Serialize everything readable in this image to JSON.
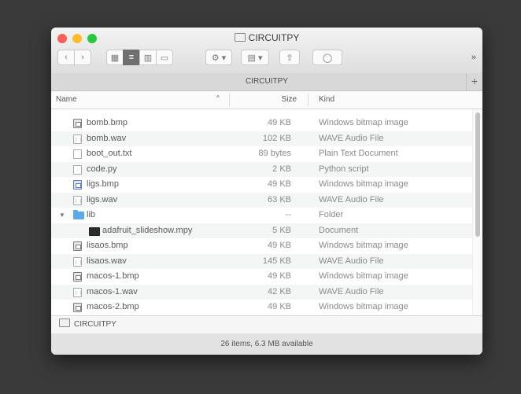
{
  "window": {
    "title": "CIRCUITPY",
    "path_title": "CIRCUITPY",
    "add_tab": "+",
    "more": "»"
  },
  "toolbar": {
    "back": "‹",
    "forward": "›",
    "view_icons": "▦",
    "view_list": "≡",
    "view_columns": "▥",
    "view_gallery": "▭",
    "action": "⚙ ▾",
    "group": "▤ ▾",
    "share": "⇧",
    "tags": "◯"
  },
  "columns": {
    "name": "Name",
    "sort": "^",
    "size": "Size",
    "kind": "Kind"
  },
  "files": [
    {
      "name": "bomb.bmp",
      "size": "49 KB",
      "kind": "Windows bitmap image",
      "icon": "image-icon",
      "indent": 0
    },
    {
      "name": "bomb.wav",
      "size": "102 KB",
      "kind": "WAVE Audio File",
      "icon": "audio-icon",
      "indent": 0
    },
    {
      "name": "boot_out.txt",
      "size": "89 bytes",
      "kind": "Plain Text Document",
      "icon": "text-file-icon",
      "indent": 0
    },
    {
      "name": "code.py",
      "size": "2 KB",
      "kind": "Python script",
      "icon": "document-icon",
      "indent": 0
    },
    {
      "name": "ligs.bmp",
      "size": "49 KB",
      "kind": "Windows bitmap image",
      "icon": "image-icon-blue",
      "indent": 0
    },
    {
      "name": "ligs.wav",
      "size": "63 KB",
      "kind": "WAVE Audio File",
      "icon": "audio-icon",
      "indent": 0
    },
    {
      "name": "lib",
      "size": "--",
      "kind": "Folder",
      "icon": "folder-icon",
      "indent": 0,
      "expanded": true
    },
    {
      "name": "adafruit_slideshow.mpy",
      "size": "5 KB",
      "kind": "Document",
      "icon": "mpy-file-icon",
      "indent": 1
    },
    {
      "name": "lisaos.bmp",
      "size": "49 KB",
      "kind": "Windows bitmap image",
      "icon": "image-icon",
      "indent": 0
    },
    {
      "name": "lisaos.wav",
      "size": "145 KB",
      "kind": "WAVE Audio File",
      "icon": "audio-icon",
      "indent": 0
    },
    {
      "name": "macos-1.bmp",
      "size": "49 KB",
      "kind": "Windows bitmap image",
      "icon": "image-icon",
      "indent": 0
    },
    {
      "name": "macos-1.wav",
      "size": "42 KB",
      "kind": "WAVE Audio File",
      "icon": "audio-icon",
      "indent": 0
    },
    {
      "name": "macos-2.bmp",
      "size": "49 KB",
      "kind": "Windows bitmap image",
      "icon": "image-icon",
      "indent": 0
    }
  ],
  "path_bar": {
    "label": "CIRCUITPY"
  },
  "status": {
    "text": "26 items, 6.3 MB available"
  },
  "colors": {
    "red": "#fc5f57",
    "yellow": "#fdbc2e",
    "green": "#29c840",
    "folder": "#5aa9e8"
  }
}
